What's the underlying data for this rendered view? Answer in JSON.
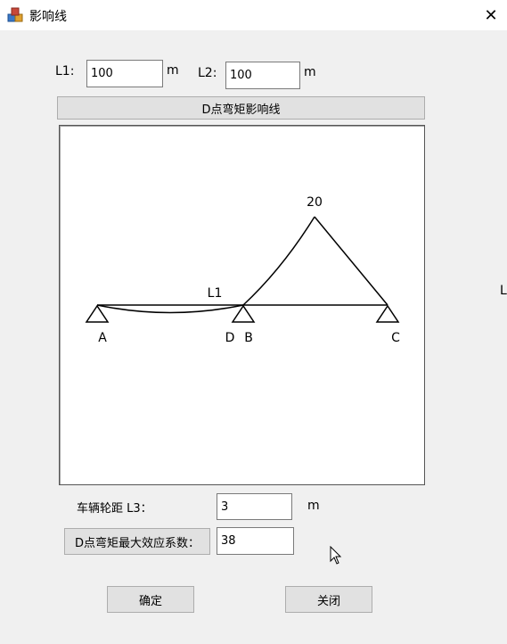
{
  "window": {
    "title": "影响线",
    "icon": "app-cubes-icon",
    "close_glyph": "✕"
  },
  "inputs": {
    "l1_label": "L1:",
    "l1_value": "100",
    "l1_unit": "m",
    "l2_label": "L2:",
    "l2_value": "100",
    "l2_unit": "m"
  },
  "diagram": {
    "header": "D点弯矩影响线",
    "peak_value": "20",
    "span_label": "L1",
    "support_a": "A",
    "point_d": "D",
    "support_b": "B",
    "support_c": "C"
  },
  "bottom": {
    "l3_label": "车辆轮距 L3：",
    "l3_value": "3",
    "l3_unit": "m",
    "coef_label": "D点弯矩最大效应系数：",
    "coef_value": "38"
  },
  "buttons": {
    "ok": "确定",
    "close": "关闭"
  },
  "edge_text": "L"
}
